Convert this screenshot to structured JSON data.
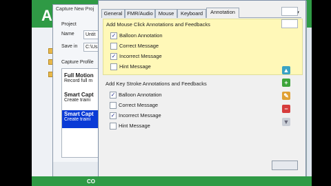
{
  "app": {
    "brand_letter": "A",
    "footer_text": "CO"
  },
  "capture_window": {
    "title": "Capture New Proj",
    "project_label": "Project",
    "name_label": "Name",
    "name_value": "Untit",
    "save_in_label": "Save in",
    "save_in_value": "C:\\Us",
    "capture_profiles_label": "Capture Profile",
    "profiles": [
      {
        "title": "Full Motion",
        "desc": "Record full m"
      },
      {
        "title": "Smart Capt",
        "desc": "Create traini"
      },
      {
        "title": "Smart Capt",
        "desc": "Create traini"
      }
    ]
  },
  "dialog": {
    "tabs": [
      {
        "label": "General"
      },
      {
        "label": "FMR/Audio"
      },
      {
        "label": "Mouse"
      },
      {
        "label": "Keyboard"
      },
      {
        "label": "Annotation"
      }
    ],
    "tab_scroll_glyph": "▾",
    "mouse_group": {
      "title": "Add Mouse Click Annotations and Feedbacks",
      "items": [
        {
          "label": "Balloon Annotation",
          "checked": "✓"
        },
        {
          "label": "Correct Message",
          "checked": ""
        },
        {
          "label": "Incorrect Message",
          "checked": "✓"
        },
        {
          "label": "Hint Message",
          "checked": ""
        }
      ]
    },
    "key_group": {
      "title": "Add Key Stroke Annotations and Feedbacks",
      "items": [
        {
          "label": "Balloon Annotation",
          "checked": "✓"
        },
        {
          "label": "Correct Message",
          "checked": ""
        },
        {
          "label": "Incorrect Message",
          "checked": "✓"
        },
        {
          "label": "Hint Message",
          "checked": ""
        }
      ]
    }
  },
  "toolbar": {
    "icons": [
      "up-arrow-icon",
      "add-icon",
      "edit-icon",
      "remove-icon",
      "down-arrow-icon"
    ]
  },
  "colors": {
    "brand_green": "#2f9a45",
    "selection_blue": "#0a3bd6",
    "highlight_yellow": "#fff8b8"
  }
}
